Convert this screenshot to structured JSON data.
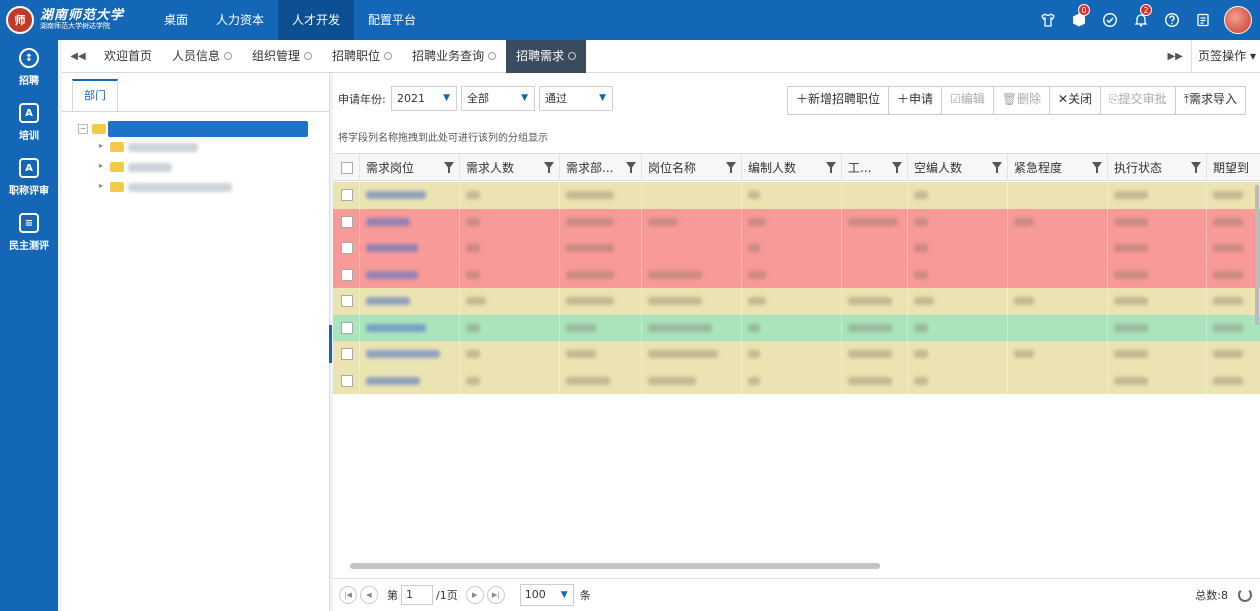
{
  "topnav": {
    "items": [
      {
        "label": "桌面"
      },
      {
        "label": "人力资本"
      },
      {
        "label": "人才开发",
        "active": true
      },
      {
        "label": "配置平台"
      }
    ],
    "badges": {
      "box": "0",
      "bell": "2"
    }
  },
  "sidebar": {
    "items": [
      {
        "label": "招聘",
        "icon": "recruit-icon"
      },
      {
        "label": "培训",
        "icon": "training-card-icon"
      },
      {
        "label": "职称评审",
        "icon": "title-review-card-icon"
      },
      {
        "label": "民主测评",
        "icon": "evaluation-form-icon"
      }
    ]
  },
  "tabs": {
    "items": [
      {
        "label": "欢迎首页",
        "closable": false
      },
      {
        "label": "人员信息",
        "closable": true
      },
      {
        "label": "组织管理",
        "closable": true
      },
      {
        "label": "招聘职位",
        "closable": true
      },
      {
        "label": "招聘业务查询",
        "closable": true
      },
      {
        "label": "招聘需求",
        "closable": true,
        "active": true
      }
    ],
    "page_ops": "页签操作"
  },
  "left_panel": {
    "dept_tab": "部门"
  },
  "filters": {
    "year_label": "申请年份:",
    "year_value": "2021",
    "scope_value": "全部",
    "status_value": "通过"
  },
  "toolbar": {
    "add_position": "＋新增招聘职位",
    "apply": "＋申请",
    "edit": "☑编辑",
    "delete": "🗑删除",
    "close": "✕关闭",
    "submit_approval": "⎘提交审批",
    "import": "⤒需求导入"
  },
  "grid": {
    "group_hint": "将字段列名称拖拽到此处可进行该列的分组显示",
    "columns": [
      {
        "label": "需求岗位"
      },
      {
        "label": "需求人数"
      },
      {
        "label": "需求部..."
      },
      {
        "label": "岗位名称"
      },
      {
        "label": "编制人数"
      },
      {
        "label": "工..."
      },
      {
        "label": "空编人数"
      },
      {
        "label": "紧急程度"
      },
      {
        "label": "执行状态"
      },
      {
        "label": "期望到"
      }
    ],
    "row_colors": [
      "#ebe3b1",
      "#f79a98",
      "#f79a98",
      "#f79a98",
      "#ebe3b1",
      "#a9e4bd",
      "#ebe3b1",
      "#ebe3b1"
    ]
  },
  "pager": {
    "page_prefix": "第",
    "page_value": "1",
    "page_suffix": "/1页",
    "size_value": "100",
    "size_unit": "条",
    "total": "总数:8"
  },
  "colors": {
    "brand": "#1467b7",
    "active_tab": "#3a4a5f"
  }
}
